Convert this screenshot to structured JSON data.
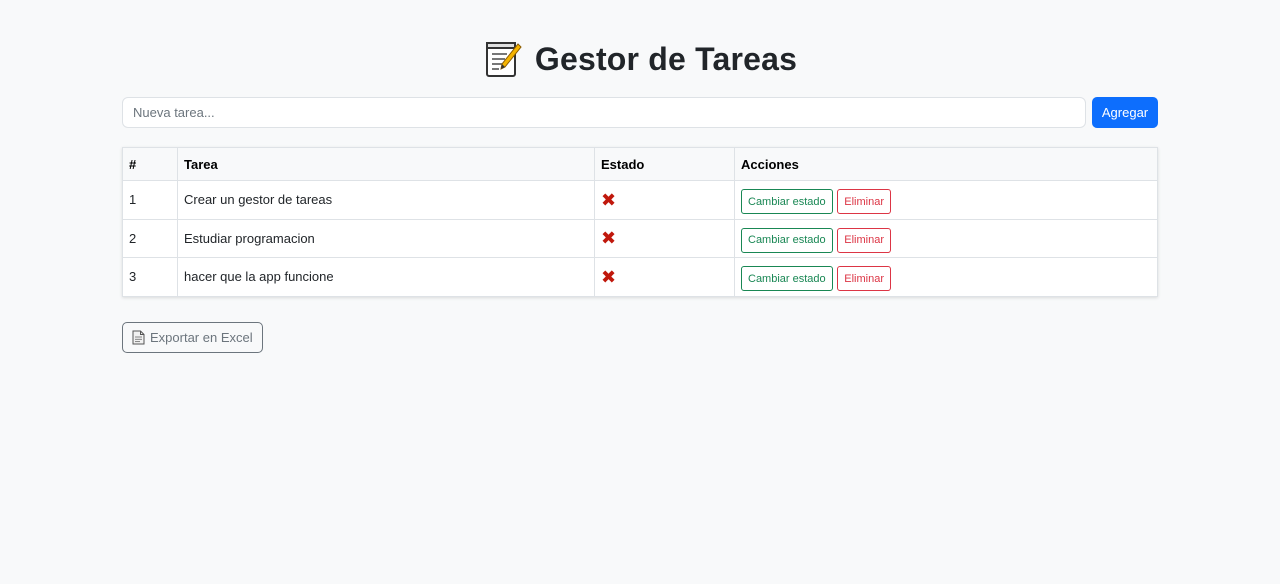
{
  "header": {
    "icon": "memo-icon",
    "title": "Gestor de Tareas"
  },
  "form": {
    "placeholder": "Nueva tarea...",
    "value": "",
    "add_label": "Agregar"
  },
  "table": {
    "columns": [
      "#",
      "Tarea",
      "Estado",
      "Acciones"
    ],
    "rows": [
      {
        "num": "1",
        "task": "Crear un gestor de tareas",
        "state": "✖",
        "state_icon": "cross-mark-icon",
        "toggle_label": "Cambiar estado",
        "delete_label": "Eliminar"
      },
      {
        "num": "2",
        "task": "Estudiar programacion",
        "state": "✖",
        "state_icon": "cross-mark-icon",
        "toggle_label": "Cambiar estado",
        "delete_label": "Eliminar"
      },
      {
        "num": "3",
        "task": "hacer que la app funcione",
        "state": "✖",
        "state_icon": "cross-mark-icon",
        "toggle_label": "Cambiar estado",
        "delete_label": "Eliminar"
      }
    ]
  },
  "export": {
    "icon": "document-icon",
    "label": "Exportar en Excel"
  },
  "colors": {
    "primary": "#0d6efd",
    "success": "#198754",
    "danger": "#dc3545",
    "secondary": "#6c757d",
    "background": "#f8f9fa"
  }
}
